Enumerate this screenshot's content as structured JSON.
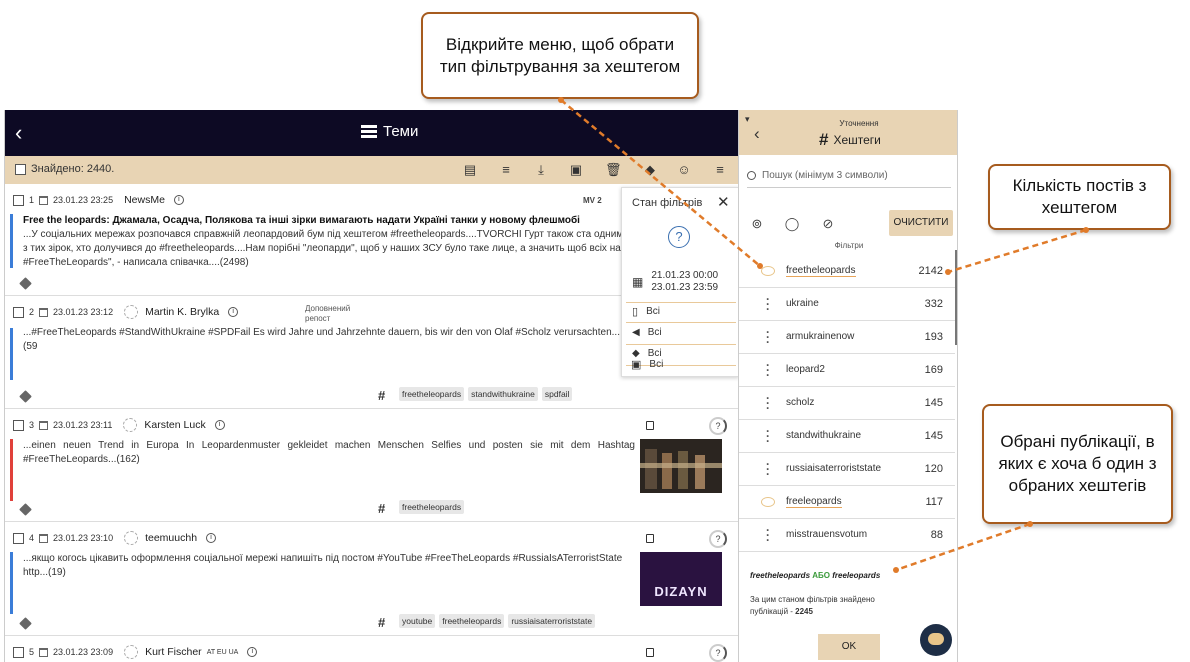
{
  "callouts": {
    "menu": "Відкрийте меню, щоб обрати тип фільтрування за хештегом",
    "count": "Кількість постів з хештегом",
    "selected": "Обрані публікації, в яких є хоча б один з обраних хештегів"
  },
  "topbar": {
    "title": "Теми",
    "back": "‹"
  },
  "toolbar": {
    "found": "Знайдено: 2440."
  },
  "posts": [
    {
      "num": "1",
      "date": "23.01.23 23:25",
      "author": "NewsMe",
      "repost": "",
      "title": "Free the leopards: Джамала, Осадча, Полякова та інші зірки вимагають надати Україні танки у новому флешмобі",
      "body": "...У соціальних мережах розпочався справжній леопардовий бум під хештегом #freetheleopards....TVORCHI Гурт також ста одними з тих зірок, хто долучився до #freetheleopards....Нам порібні \"леопарди\", щоб у наших ЗСУ було таке лице, а значить щоб всіх нас #FreeTheLeopards\", - написала співачка....(2498)",
      "badge": "MV 2"
    },
    {
      "num": "2",
      "date": "23.01.23 23:12",
      "author": "Martin K. Brylka",
      "repost": "Доповнений репост",
      "title": "",
      "body": "...#FreeTheLeopards #StandWithUkraine #SPDFail  Es wird Jahre und Jahrzehnte dauern, bis wir den von Olaf #Scholz verursachten...(59",
      "tags": [
        "freetheleopards",
        "standwithukraine",
        "spdfail"
      ]
    },
    {
      "num": "3",
      "date": "23.01.23 23:11",
      "author": "Karsten Luck",
      "repost": "",
      "title": "",
      "body": "...einen neuen Trend in Europa In Leopardenmuster gekleidet machen Menschen Selfies und posten sie mit dem Hashtag #FreeTheLeopards...(162)",
      "tags": [
        "freetheleopards"
      ]
    },
    {
      "num": "4",
      "date": "23.01.23 23:10",
      "author": "teemuuchh",
      "repost": "",
      "title": "",
      "body": "...якщо когось цікавить оформлення соціальної мережі напишіть під постом #YouTube #FreeTheLeopards #RussiaIsATerroristState http...(19)",
      "tags": [
        "youtube",
        "freetheleopards",
        "russiaisaterroriststate"
      ],
      "thumb_text": "DIZAYN"
    },
    {
      "num": "5",
      "date": "23.01.23 23:09",
      "author": "Kurt Fischer",
      "author_suffix": "AT EU UA",
      "repost": "",
      "title": "",
      "body": ""
    }
  ],
  "filter_popup": {
    "title": "Стан фільтрів",
    "date_from": "21.01.23 00:00",
    "date_to": "23.01.23 23:59",
    "rows": [
      "Всі",
      "Всі",
      "Всі",
      "Всі"
    ]
  },
  "right_panel": {
    "subtitle": "Уточнення",
    "title": "Хештеги",
    "search_placeholder": "Пошук (мінімум 3 символи)",
    "clear": "ОЧИСТИТИ",
    "filters_label": "Фільтри",
    "hashtags": [
      {
        "name": "freetheleopards",
        "count": "2142",
        "selected": true
      },
      {
        "name": "ukraine",
        "count": "332",
        "selected": false
      },
      {
        "name": "armukrainenow",
        "count": "193",
        "selected": false
      },
      {
        "name": "leopard2",
        "count": "169",
        "selected": false
      },
      {
        "name": "scholz",
        "count": "145",
        "selected": false
      },
      {
        "name": "standwithukraine",
        "count": "145",
        "selected": false
      },
      {
        "name": "russiaisaterroriststate",
        "count": "120",
        "selected": false
      },
      {
        "name": "freeleopards",
        "count": "117",
        "selected": true
      },
      {
        "name": "misstrauensvotum",
        "count": "88",
        "selected": false
      }
    ],
    "expression": {
      "a": "freetheleopards",
      "op": "АБО",
      "b": "freeleopards"
    },
    "found_note": "За цим станом фільтрів знайдено публікацій - ",
    "found_count": "2245",
    "ok": "OK"
  },
  "colors": {
    "accent": "#e8d4b4",
    "topbar": "#0d0a24",
    "callout_border": "#a65b1e",
    "arrow": "#e07b2a"
  }
}
